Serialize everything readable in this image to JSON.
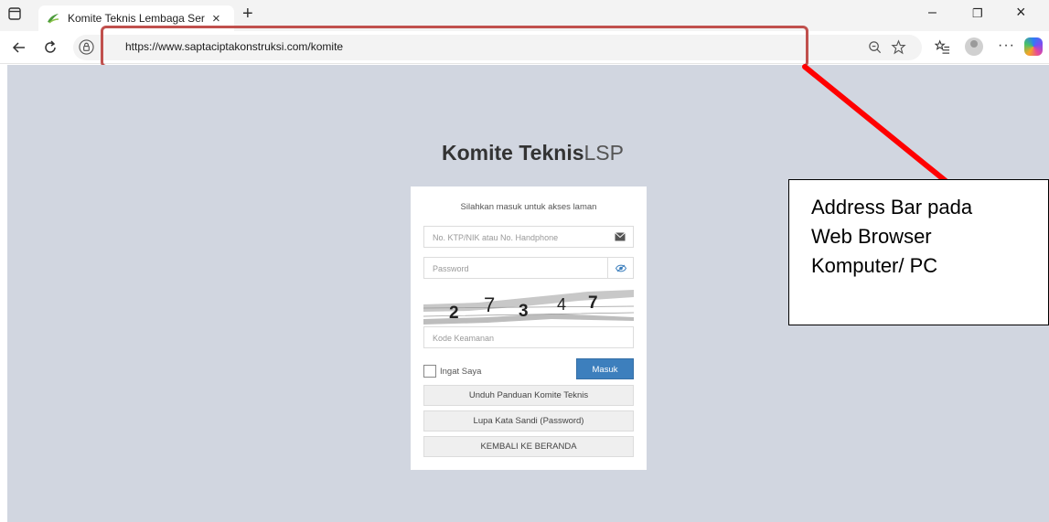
{
  "browser": {
    "tab": {
      "title": "Komite Teknis Lembaga Sertifikasi",
      "close_glyph": "×"
    },
    "new_tab_glyph": "+",
    "window_controls": {
      "minimize": "–",
      "restore": "❐",
      "close": "×"
    },
    "url": "https://www.saptaciptakonstruksi.com/komite",
    "more_glyph": "···",
    "icons": [
      "sidebar-icon",
      "favicon-icon",
      "back-icon",
      "reload-icon",
      "site-info-icon",
      "zoom-icon",
      "favorite-star-icon",
      "favorites-icon",
      "profile-icon",
      "more-icon",
      "copilot-icon"
    ],
    "accent_colors": {
      "highlight": "#c0504d",
      "arrow": "#ff0000"
    }
  },
  "page": {
    "brand": {
      "bold": "Komite Teknis",
      "light": "LSP"
    },
    "login": {
      "lead": "Silahkan masuk untuk akses laman",
      "id_placeholder": "No. KTP/NIK atau No. Handphone",
      "password_placeholder": "Password",
      "captcha_digits": [
        "2",
        "7",
        "3",
        "4",
        "7"
      ],
      "code_placeholder": "Kode Keamanan",
      "remember_label": "Ingat Saya",
      "submit_label": "Masuk",
      "guide_button": "Unduh Panduan Komite Teknis",
      "forgot_button": "Lupa Kata Sandi (Password)",
      "home_button": "KEMBALI KE BERANDA"
    },
    "colors": {
      "background": "#d1d6e0",
      "primary_button": "#3d7fbd"
    }
  },
  "annotation": {
    "lines": [
      "Address Bar pada",
      "Web Browser",
      "Komputer/ PC"
    ]
  }
}
